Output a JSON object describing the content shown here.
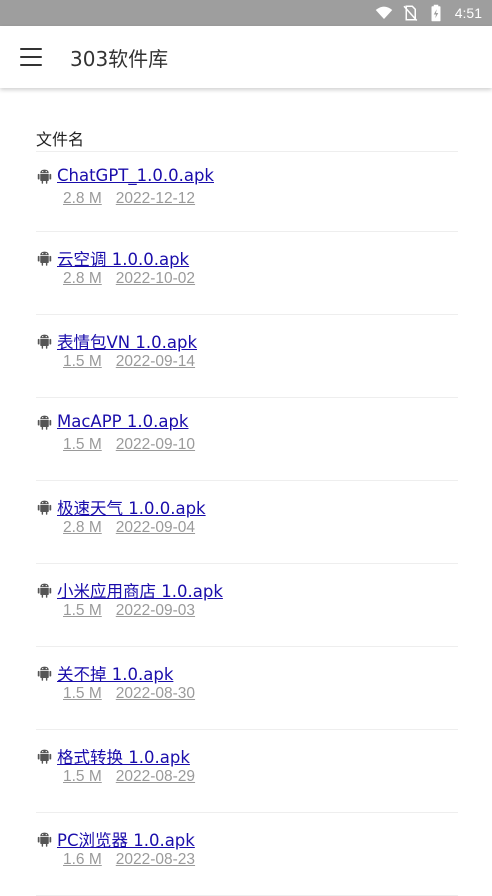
{
  "status_bar": {
    "time": "4:51",
    "icons": [
      "wifi-icon",
      "no-sim-icon",
      "battery-icon"
    ]
  },
  "app_bar": {
    "menu_icon": "hamburger-menu-icon",
    "title": "303软件库"
  },
  "list": {
    "header": "文件名",
    "file_icon": "android-icon",
    "items": [
      {
        "name": "ChatGPT_1.0.0.apk",
        "size": "2.8 M",
        "date": "2022-12-12"
      },
      {
        "name": "云空调 1.0.0.apk",
        "size": "2.8 M",
        "date": "2022-10-02"
      },
      {
        "name": "表情包VN 1.0.apk",
        "size": "1.5 M",
        "date": "2022-09-14"
      },
      {
        "name": "MacAPP 1.0.apk",
        "size": "1.5 M",
        "date": "2022-09-10"
      },
      {
        "name": "极速天气 1.0.0.apk",
        "size": "2.8 M",
        "date": "2022-09-04"
      },
      {
        "name": "小米应用商店 1.0.apk",
        "size": "1.5 M",
        "date": "2022-09-03"
      },
      {
        "name": "关不掉 1.0.apk",
        "size": "1.5 M",
        "date": "2022-08-30"
      },
      {
        "name": "格式转换 1.0.apk",
        "size": "1.5 M",
        "date": "2022-08-29"
      },
      {
        "name": "PC浏览器 1.0.apk",
        "size": "1.6 M",
        "date": "2022-08-23"
      }
    ]
  },
  "colors": {
    "status_bar": "#9e9e9e",
    "link": "#1a0dab",
    "meta": "#9a9a9a"
  }
}
